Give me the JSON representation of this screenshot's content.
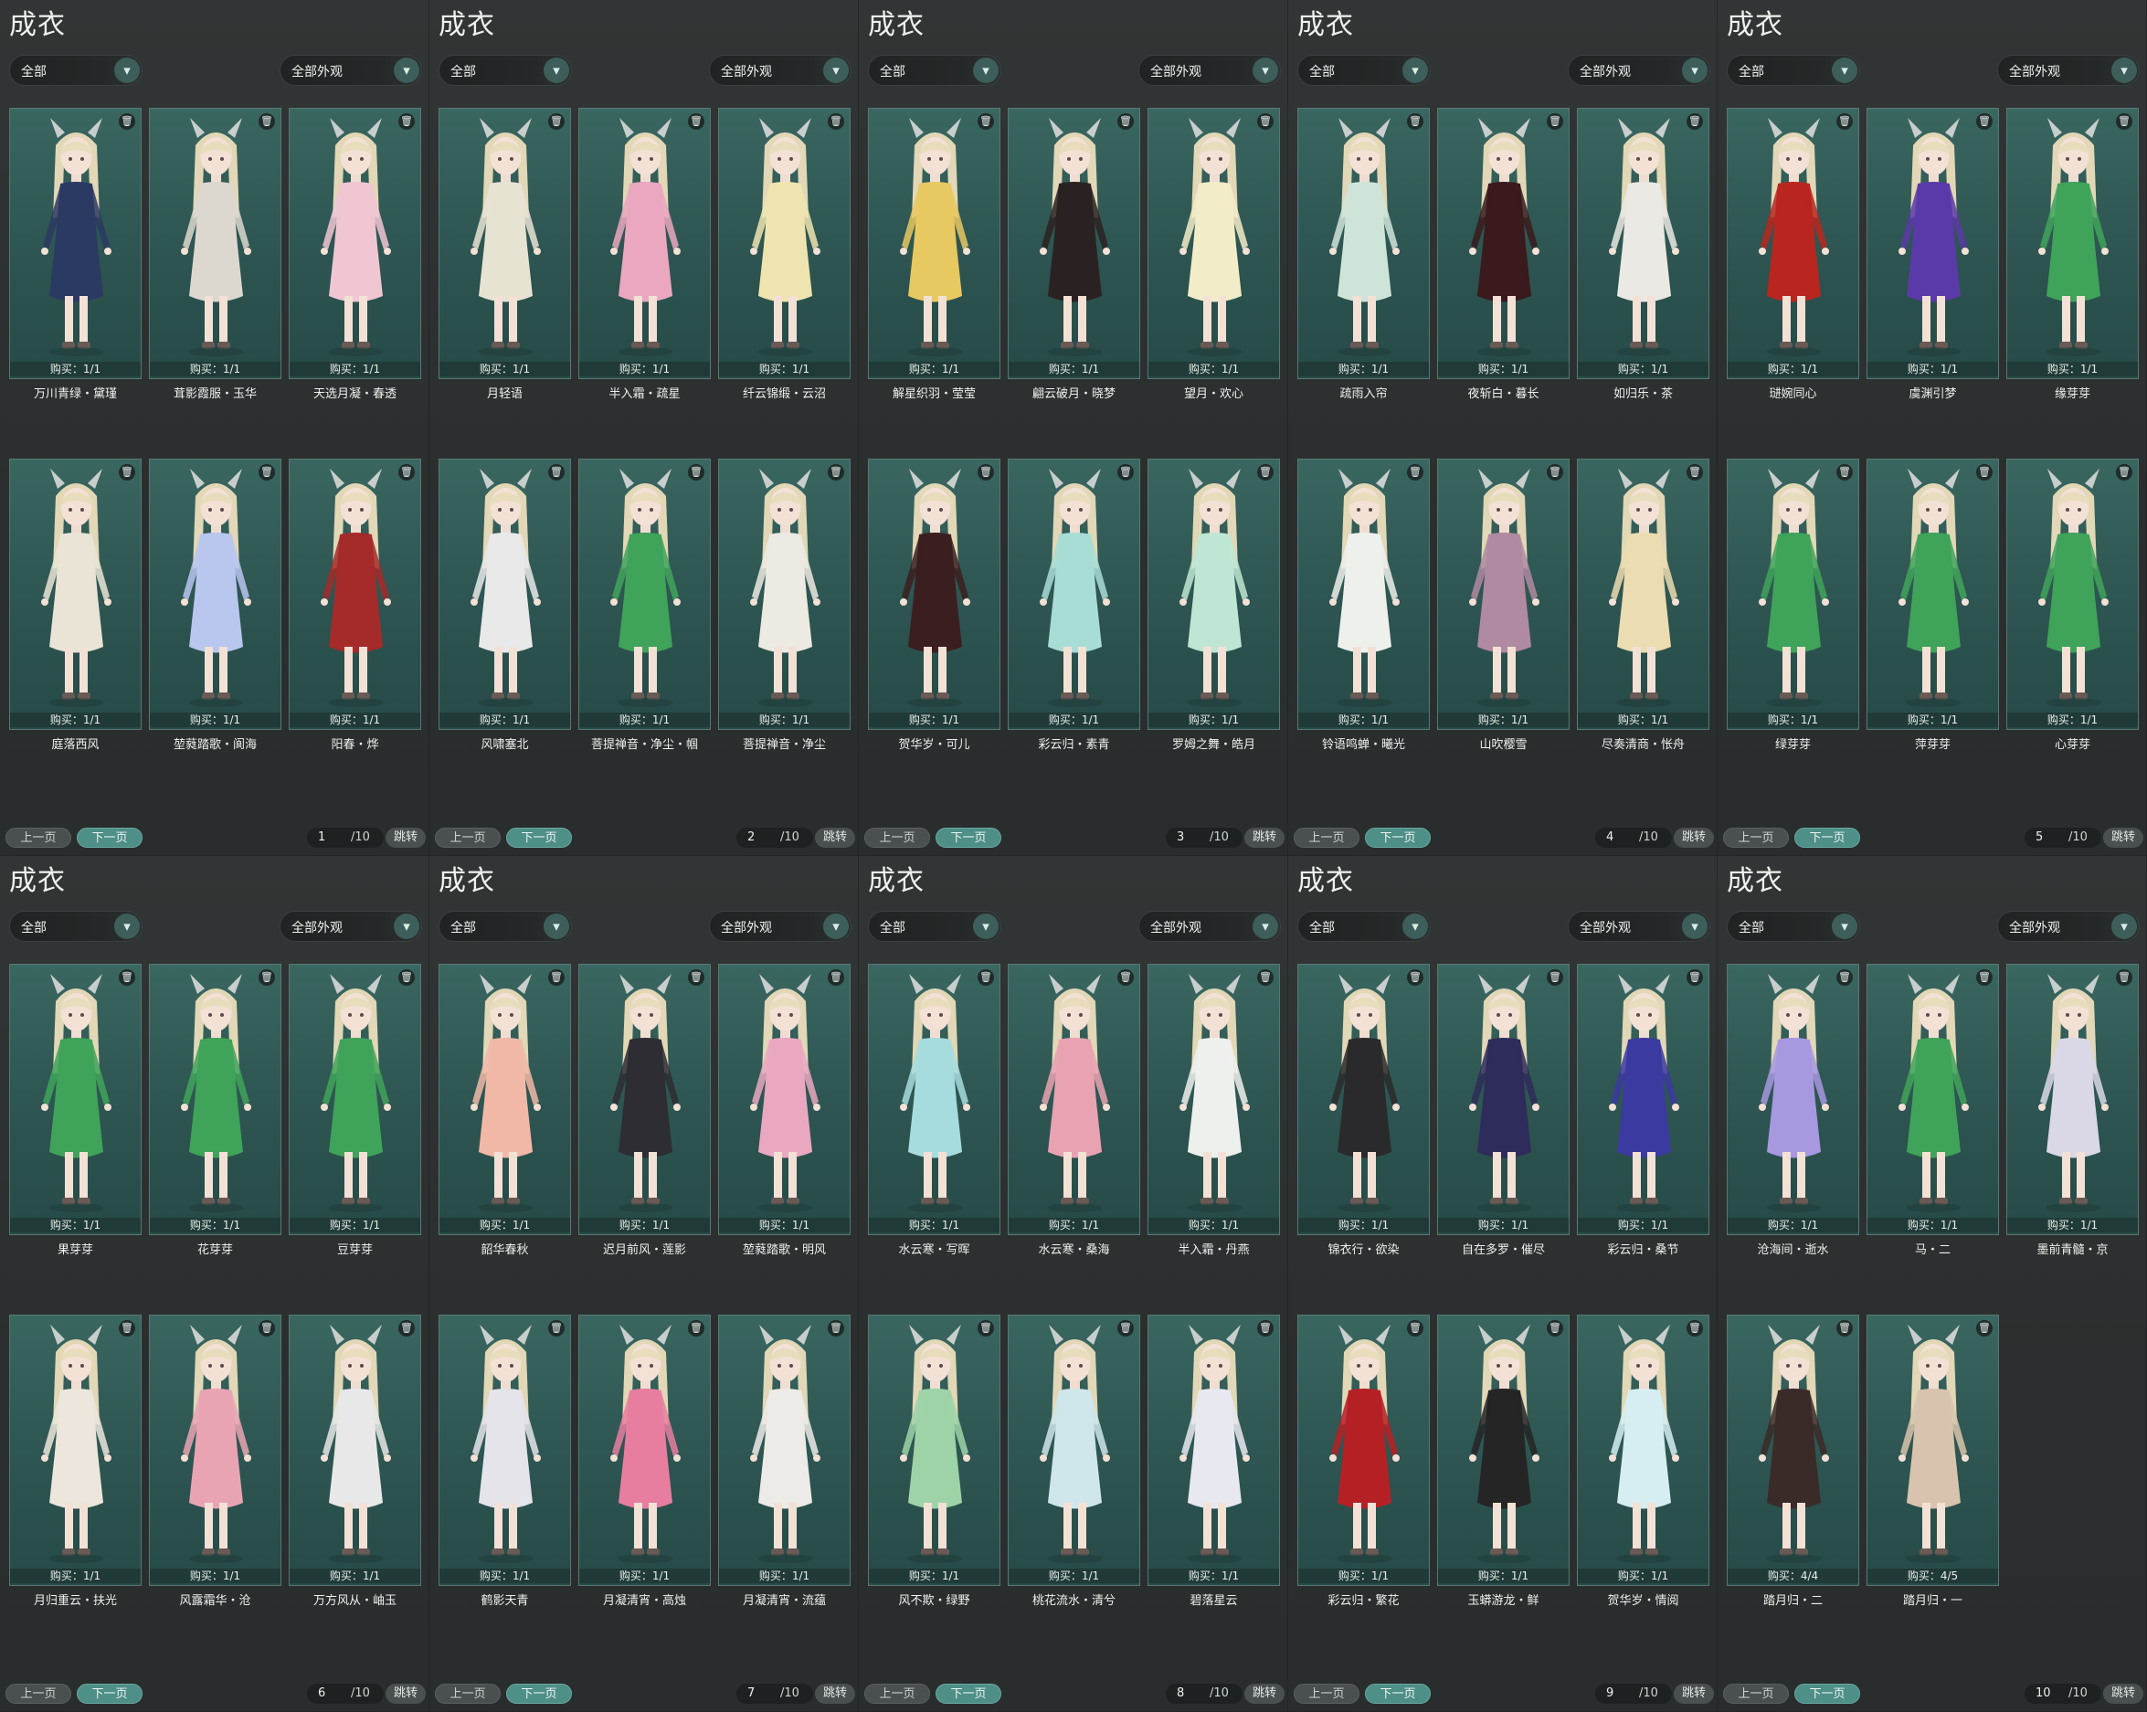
{
  "labels": {
    "title": "成衣",
    "category_filter": "全部",
    "appearance_filter": "全部外观",
    "prev_page": "上一页",
    "next_page": "下一页",
    "jump": "跳转",
    "trash_icon": "delete-icon",
    "dropdown_icon": "chevron-down-icon"
  },
  "colors": {
    "card_bg": "#2f5753",
    "next_button": "#4e8f87",
    "dropdown_arrow": "#3d5e5a",
    "background": "#2c2f2f"
  },
  "panels": [
    {
      "page": "1",
      "total": "/10",
      "items": [
        {
          "name": "万川青绿・黛瑾",
          "buy": "购买：1/1",
          "outfit": "#2b3a63"
        },
        {
          "name": "茸影霞服・玉华",
          "buy": "购买：1/1",
          "outfit": "#dcd8cf"
        },
        {
          "name": "天选月凝・春透",
          "buy": "购买：1/1",
          "outfit": "#f0c6d3"
        },
        {
          "name": "庭落西风",
          "buy": "购买：1/1",
          "outfit": "#e9e4d6"
        },
        {
          "name": "堃蕤踏歌・阆海",
          "buy": "购买：1/1",
          "outfit": "#b9c6ee"
        },
        {
          "name": "阳春・烨",
          "buy": "购买：1/1",
          "outfit": "#a52a2a"
        }
      ]
    },
    {
      "page": "2",
      "total": "/10",
      "items": [
        {
          "name": "月轻语",
          "buy": "购买：1/1",
          "outfit": "#e7e3d3"
        },
        {
          "name": "半入霜・疏星",
          "buy": "购买：1/1",
          "outfit": "#eaa7bf"
        },
        {
          "name": "纤云锦缎・云沼",
          "buy": "购买：1/1",
          "outfit": "#efe4b0"
        },
        {
          "name": "风啸塞北",
          "buy": "购买：1/1",
          "outfit": "#e9e9e9"
        },
        {
          "name": "菩提禅音・净尘・帼",
          "buy": "购买：1/1",
          "outfit": "#3fa35a"
        },
        {
          "name": "菩提禅音・净尘",
          "buy": "购买：1/1",
          "outfit": "#eceae2"
        }
      ]
    },
    {
      "page": "3",
      "total": "/10",
      "items": [
        {
          "name": "解星织羽・莹莹",
          "buy": "购买：1/1",
          "outfit": "#e8c860"
        },
        {
          "name": "翩云破月・晓梦",
          "buy": "购买：1/1",
          "outfit": "#2a2222"
        },
        {
          "name": "望月・欢心",
          "buy": "购买：1/1",
          "outfit": "#f3ecc8"
        },
        {
          "name": "贺华岁・可儿",
          "buy": "购买：1/1",
          "outfit": "#3b1f20"
        },
        {
          "name": "彩云归・素青",
          "buy": "购买：1/1",
          "outfit": "#a8ddd5"
        },
        {
          "name": "罗姆之舞・皓月",
          "buy": "购买：1/1",
          "outfit": "#bfe6d4"
        }
      ]
    },
    {
      "page": "4",
      "total": "/10",
      "items": [
        {
          "name": "疏雨入帘",
          "buy": "购买：1/1",
          "outfit": "#cfe4d8"
        },
        {
          "name": "夜斩白・暮长",
          "buy": "购买：1/1",
          "outfit": "#3a1a1c"
        },
        {
          "name": "如归乐・茶",
          "buy": "购买：1/1",
          "outfit": "#ebe9e4"
        },
        {
          "name": "铃语鸣蝉・曦光",
          "buy": "购买：1/1",
          "outfit": "#eef0ec"
        },
        {
          "name": "山吹樱雪",
          "buy": "购买：1/1",
          "outfit": "#b08aa0"
        },
        {
          "name": "尽奏清商・怅舟",
          "buy": "购买：1/1",
          "outfit": "#ecdcb2"
        }
      ]
    },
    {
      "page": "5",
      "total": "/10",
      "items": [
        {
          "name": "琎婉同心",
          "buy": "购买：1/1",
          "outfit": "#b8261f"
        },
        {
          "name": "虞渊引梦",
          "buy": "购买：1/1",
          "outfit": "#5a3aa8"
        },
        {
          "name": "缘芽芽",
          "buy": "购买：1/1",
          "outfit": "#3fa35a"
        },
        {
          "name": "绿芽芽",
          "buy": "购买：1/1",
          "outfit": "#3fa35a"
        },
        {
          "name": "萍芽芽",
          "buy": "购买：1/1",
          "outfit": "#3fa35a"
        },
        {
          "name": "心芽芽",
          "buy": "购买：1/1",
          "outfit": "#3fa35a"
        }
      ]
    },
    {
      "page": "6",
      "total": "/10",
      "items": [
        {
          "name": "果芽芽",
          "buy": "购买：1/1",
          "outfit": "#3fa35a"
        },
        {
          "name": "花芽芽",
          "buy": "购买：1/1",
          "outfit": "#3fa35a"
        },
        {
          "name": "豆芽芽",
          "buy": "购买：1/1",
          "outfit": "#3fa35a"
        },
        {
          "name": "月归重云・扶光",
          "buy": "购买：1/1",
          "outfit": "#ece6dc"
        },
        {
          "name": "风露霜华・沧",
          "buy": "购买：1/1",
          "outfit": "#e9a4b4"
        },
        {
          "name": "万方风从・岫玉",
          "buy": "购买：1/1",
          "outfit": "#e8e8e8"
        }
      ]
    },
    {
      "page": "7",
      "total": "/10",
      "items": [
        {
          "name": "韶华春秋",
          "buy": "购买：1/1",
          "outfit": "#f1b8a8"
        },
        {
          "name": "迟月前风・莲影",
          "buy": "购买：1/1",
          "outfit": "#2d2d33"
        },
        {
          "name": "堃蕤踏歌・明风",
          "buy": "购买：1/1",
          "outfit": "#e9a8c0"
        },
        {
          "name": "鹤影天青",
          "buy": "购买：1/1",
          "outfit": "#e4e4ea"
        },
        {
          "name": "月凝清宵・高烛",
          "buy": "购买：1/1",
          "outfit": "#e77ea0"
        },
        {
          "name": "月凝清宵・流蕴",
          "buy": "购买：1/1",
          "outfit": "#ecebe8"
        }
      ]
    },
    {
      "page": "8",
      "total": "/10",
      "items": [
        {
          "name": "水云寒・写晖",
          "buy": "购买：1/1",
          "outfit": "#a7dcde"
        },
        {
          "name": "水云寒・桑海",
          "buy": "购买：1/1",
          "outfit": "#e9a2b2"
        },
        {
          "name": "半入霜・丹燕",
          "buy": "购买：1/1",
          "outfit": "#eef0ee"
        },
        {
          "name": "风不欺・绿野",
          "buy": "购买：1/1",
          "outfit": "#9ed3a8"
        },
        {
          "name": "桃花流水・清兮",
          "buy": "购买：1/1",
          "outfit": "#cfe6ea"
        },
        {
          "name": "碧落星云",
          "buy": "购买：1/1",
          "outfit": "#e8e8f0"
        }
      ]
    },
    {
      "page": "9",
      "total": "/10",
      "items": [
        {
          "name": "锦衣行・欲染",
          "buy": "购买：1/1",
          "outfit": "#2a2a2c"
        },
        {
          "name": "自在多罗・催尽",
          "buy": "购买：1/1",
          "outfit": "#2e2c5a"
        },
        {
          "name": "彩云归・桑节",
          "buy": "购买：1/1",
          "outfit": "#3b3aa0"
        },
        {
          "name": "彩云归・繁花",
          "buy": "购买：1/1",
          "outfit": "#b52025"
        },
        {
          "name": "玉蟒游龙・鲜",
          "buy": "购买：1/1",
          "outfit": "#252526"
        },
        {
          "name": "贺华岁・情阅",
          "buy": "购买：1/1",
          "outfit": "#d6eef2"
        }
      ]
    },
    {
      "page": "10",
      "total": "/10",
      "items": [
        {
          "name": "沧海间・逝水",
          "buy": "购买：1/1",
          "outfit": "#a798e0"
        },
        {
          "name": "马・二",
          "buy": "购买：1/1",
          "outfit": "#3fa35a"
        },
        {
          "name": "墨前青髓・京",
          "buy": "购买：1/1",
          "outfit": "#dad8e6"
        },
        {
          "name": "踏月归・二",
          "buy": "购买：4/4",
          "outfit": "#3a2a28"
        },
        {
          "name": "踏月归・一",
          "buy": "购买：4/5",
          "outfit": "#d8c4ae"
        }
      ]
    }
  ]
}
